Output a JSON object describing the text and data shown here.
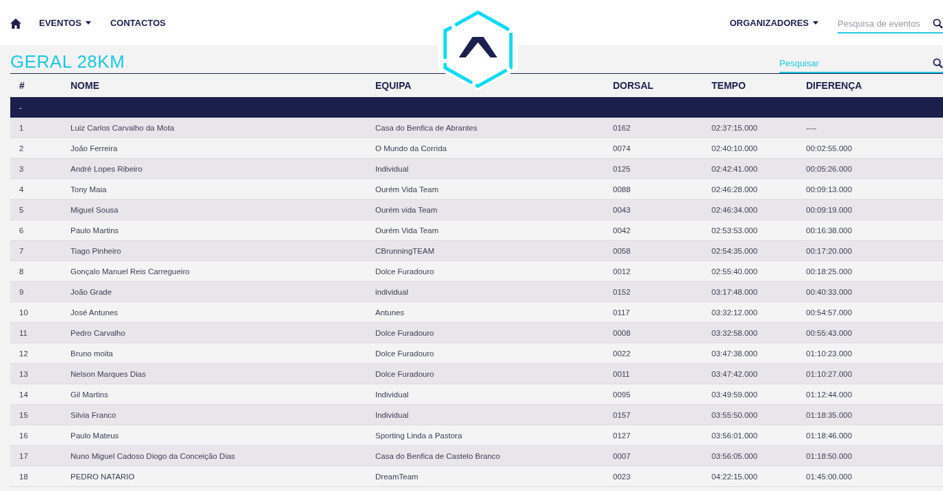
{
  "nav": {
    "items": [
      {
        "label": "EVENTOS",
        "dropdown": true
      },
      {
        "label": "CONTACTOS",
        "dropdown": false
      }
    ],
    "right_items": [
      {
        "label": "ORGANIZADORES",
        "dropdown": true
      }
    ],
    "search": {
      "placeholder": "Pesquisa de eventos"
    }
  },
  "title": "GERAL 28KM",
  "table_search": {
    "placeholder": "Pesquisar"
  },
  "table": {
    "columns": [
      "#",
      "NOME",
      "EQUIPA",
      "DORSAL",
      "TEMPO",
      "DIFERENÇA"
    ],
    "group": "-",
    "rows": [
      [
        "1",
        "Luiz Carlos Carvalho da Mota",
        "Casa do Benfica de Abrantes",
        "0162",
        "02:37:15.000",
        "----"
      ],
      [
        "2",
        "João Ferreira",
        "O Mundo da Corrida",
        "0074",
        "02:40:10.000",
        "00:02:55.000"
      ],
      [
        "3",
        "André Lopes Ribeiro",
        "Individual",
        "0125",
        "02:42:41.000",
        "00:05:26.000"
      ],
      [
        "4",
        "Tony Maia",
        "Ourém Vida Team",
        "0088",
        "02:46:28.000",
        "00:09:13.000"
      ],
      [
        "5",
        "Miguel Sousa",
        "Ourém vida Team",
        "0043",
        "02:46:34.000",
        "00:09:19.000"
      ],
      [
        "6",
        "Paulo Martins",
        "Ourém Vida Team",
        "0042",
        "02:53:53.000",
        "00:16:38.000"
      ],
      [
        "7",
        "Tiago Pinheiro",
        "CBrunningTEAM",
        "0058",
        "02:54:35.000",
        "00:17:20.000"
      ],
      [
        "8",
        "Gonçalo Manuel Reis Carregueiro",
        "Dolce Furadouro",
        "0012",
        "02:55:40.000",
        "00:18:25.000"
      ],
      [
        "9",
        "João Grade",
        "individual",
        "0152",
        "03:17:48.000",
        "00:40:33.000"
      ],
      [
        "10",
        "José Antunes",
        "Antunes",
        "0117",
        "03:32:12.000",
        "00:54:57.000"
      ],
      [
        "11",
        "Pedro Carvalho",
        "Dolce Furadouro",
        "0008",
        "03:32:58.000",
        "00:55:43.000"
      ],
      [
        "12",
        "Bruno moita",
        "Dolce Furadouro",
        "0022",
        "03:47:38.000",
        "01:10:23.000"
      ],
      [
        "13",
        "Nelson Marques Dias",
        "Dolce Furadouro",
        "0011",
        "03:47:42.000",
        "01:10:27.000"
      ],
      [
        "14",
        "Gil Martins",
        "Individual",
        "0095",
        "03:49:59.000",
        "01:12:44.000"
      ],
      [
        "15",
        "Silvia Franco",
        "Individual",
        "0157",
        "03:55:50.000",
        "01:18:35.000"
      ],
      [
        "16",
        "Paulo Mateus",
        "Sporting Linda a Pastora",
        "0127",
        "03:56:01.000",
        "01:18:46.000"
      ],
      [
        "17",
        "Nuno Miguel Cadoso Diogo da Conceição Dias",
        "Casa do Benfica de Castelo Branco",
        "0007",
        "03:56:05.000",
        "01:18:50.000"
      ],
      [
        "18",
        "PEDRO NATARIO",
        "DreamTeam",
        "0023",
        "04:22:15.000",
        "01:45:00.000"
      ]
    ]
  }
}
